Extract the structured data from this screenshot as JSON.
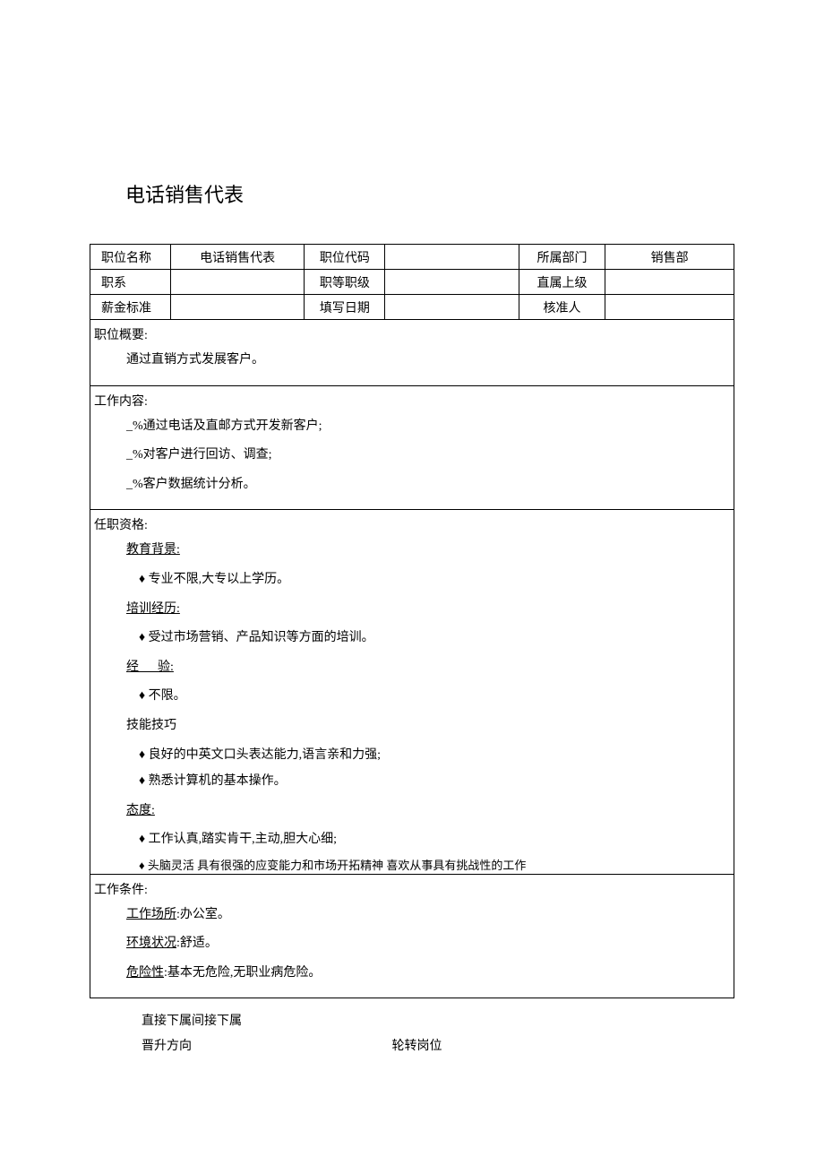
{
  "title": "电话销售代表",
  "header": {
    "r1": {
      "c1": "职位名称",
      "c2": "电话销售代表",
      "c3": "职位代码",
      "c4": "",
      "c5": "所属部门",
      "c6": "销售部"
    },
    "r2": {
      "c1": "职系",
      "c2": "",
      "c3": "职等职级",
      "c4": "",
      "c5": "直属上级",
      "c6": ""
    },
    "r3": {
      "c1": "薪金标准",
      "c2": "",
      "c3": "填写日期",
      "c4": "",
      "c5": "核准人",
      "c6": ""
    }
  },
  "overview": {
    "label": "职位概要:",
    "text": "通过直销方式发展客户。"
  },
  "content": {
    "label": "工作内容:",
    "items": [
      "_%通过电话及直邮方式开发新客户;",
      "_%对客户进行回访、调查;",
      "_%客户数据统计分析。"
    ]
  },
  "qual": {
    "label": "任职资格:",
    "edu": {
      "h": "教育背景:",
      "i": "专业不限,大专以上学历。"
    },
    "train": {
      "h": "培训经历:",
      "i": "受过市场营销、产品知识等方面的培训。"
    },
    "exp": {
      "h_a": "经",
      "h_b": "验:",
      "i": "不限。"
    },
    "skill": {
      "h": "技能技巧",
      "i1": "良好的中英文口头表达能力,语言亲和力强;",
      "i2": "熟悉计算机的基本操作。"
    },
    "att": {
      "h": "态度:",
      "i1": "工作认真,踏实肯干,主动,胆大心细;",
      "i2": "头脑灵活 具有很强的应变能力和市场开拓精神 喜欢从事具有挑战性的工作"
    }
  },
  "cond": {
    "label": "工作条件:",
    "place": {
      "h": "工作场所",
      "t": ":办公室。"
    },
    "env": {
      "h": "环境状况",
      "t": ":舒适。"
    },
    "risk": {
      "h": "危险性",
      "t": ":基本无危险,无职业病危险。"
    }
  },
  "footer": {
    "line1": "直接下属间接下属",
    "line2a": "晋升方向",
    "line2b": "轮转岗位"
  }
}
